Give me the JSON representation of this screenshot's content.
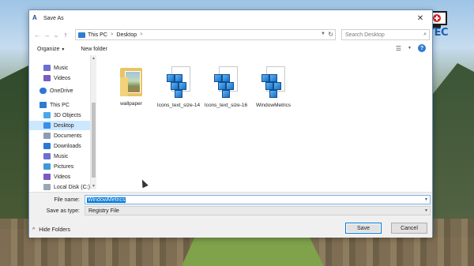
{
  "window": {
    "title": "Save As",
    "close": "✕"
  },
  "nav": {
    "back": "←",
    "forward": "→",
    "dropdown": "⌄",
    "up": "↑",
    "breadcrumb": [
      "This PC",
      "Desktop"
    ],
    "separator": ">",
    "search_placeholder": "Search Desktop"
  },
  "toolbar": {
    "organize": "Organize",
    "new_folder": "New folder"
  },
  "sidebar": {
    "items": [
      {
        "label": "Music",
        "icon": "music-icon"
      },
      {
        "label": "Videos",
        "icon": "videos-icon"
      },
      {
        "label": "OneDrive",
        "icon": "onedrive-icon"
      },
      {
        "label": "This PC",
        "icon": "this-pc-icon"
      },
      {
        "label": "3D Objects",
        "icon": "3d-objects-icon"
      },
      {
        "label": "Desktop",
        "icon": "desktop-icon",
        "selected": true
      },
      {
        "label": "Documents",
        "icon": "documents-icon"
      },
      {
        "label": "Downloads",
        "icon": "downloads-icon"
      },
      {
        "label": "Music",
        "icon": "music-icon"
      },
      {
        "label": "Pictures",
        "icon": "pictures-icon"
      },
      {
        "label": "Videos",
        "icon": "videos-icon"
      },
      {
        "label": "Local Disk (C:)",
        "icon": "local-disk-icon"
      }
    ]
  },
  "files": [
    {
      "name": "wallpaper",
      "type": "folder"
    },
    {
      "name": "Icons_text_size-14",
      "type": "registry"
    },
    {
      "name": "Icons_text_size-16",
      "type": "registry"
    },
    {
      "name": "WindowMetrics",
      "type": "registry"
    }
  ],
  "form": {
    "file_name_label": "File name:",
    "file_name_value": "WindowMetrics",
    "save_type_label": "Save as type:",
    "save_type_value": "Registry File"
  },
  "footer": {
    "hide_folders": "Hide Folders",
    "save": "Save",
    "cancel": "Cancel"
  },
  "brand": {
    "text": "BRITEC"
  }
}
